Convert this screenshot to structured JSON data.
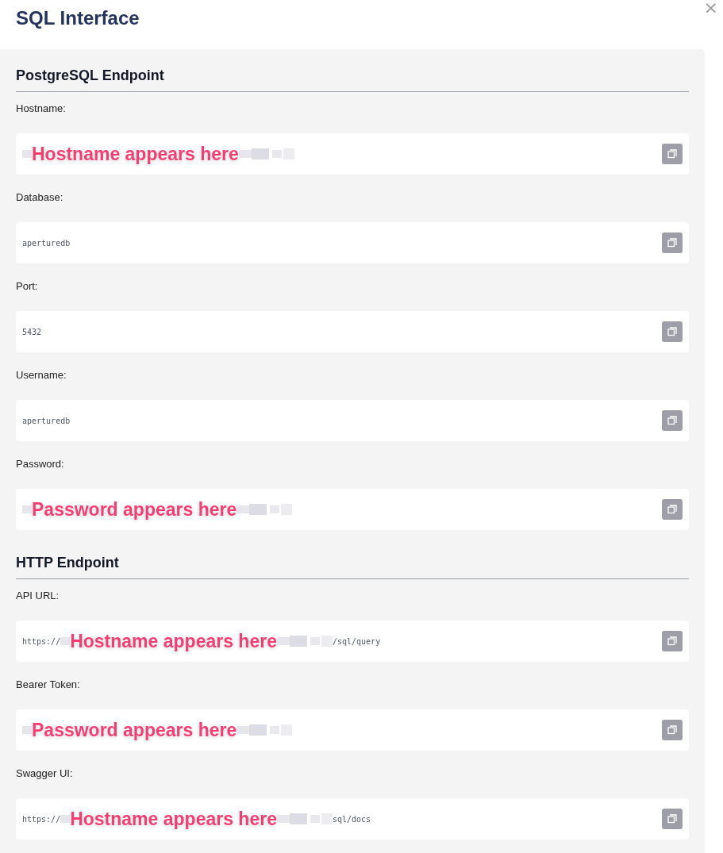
{
  "dialog": {
    "title": "SQL Interface",
    "close": "×"
  },
  "sections": [
    {
      "heading": "PostgreSQL Endpoint",
      "fields": [
        {
          "kind": "redacted",
          "label": "Hostname:",
          "annotation": "Hostname appears here"
        },
        {
          "kind": "plain",
          "label": "Database:",
          "value": "aperturedb"
        },
        {
          "kind": "plain",
          "label": "Port:",
          "value": "5432"
        },
        {
          "kind": "plain",
          "label": "Username:",
          "value": "aperturedb"
        },
        {
          "kind": "redacted",
          "label": "Password:",
          "annotation": "Password appears here"
        }
      ]
    },
    {
      "heading": "HTTP Endpoint",
      "fields": [
        {
          "kind": "redacted",
          "label": "API URL:",
          "prefix": "https://",
          "annotation": "Hostname appears here",
          "suffix": "/sql/query"
        },
        {
          "kind": "redacted",
          "label": "Bearer Token:",
          "annotation": "Password appears here"
        },
        {
          "kind": "redacted",
          "label": "Swagger UI:",
          "prefix": "https://",
          "annotation": "Hostname appears here",
          "suffix": "sql/docs"
        }
      ]
    }
  ]
}
